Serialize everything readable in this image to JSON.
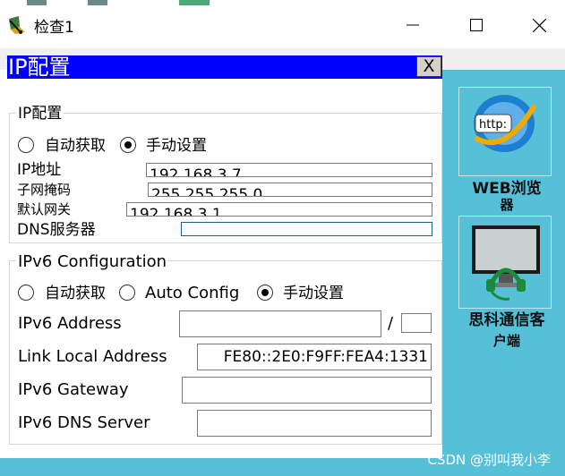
{
  "window": {
    "title": "检查1",
    "app_icon": "packet-tracer-icon",
    "controls": [
      "minimize-icon",
      "maximize-icon",
      "close-icon"
    ]
  },
  "panel": {
    "title": "IP配置",
    "close_label": "X"
  },
  "ipv4": {
    "legend": "IP配置",
    "mode_options": [
      {
        "label": "自动获取",
        "selected": false
      },
      {
        "label": "手动设置",
        "selected": true
      }
    ],
    "fields": {
      "ip_label": "IP地址",
      "ip_value": "192.168.3.7",
      "mask_label": "子网掩码",
      "mask_value": "255.255.255.0",
      "gateway_label": "默认网关",
      "gateway_value": "192.168.3.1",
      "dns_label": "DNS服务器",
      "dns_value": ""
    }
  },
  "ipv6": {
    "legend": "IPv6 Configuration",
    "mode_options": [
      {
        "label": "自动获取",
        "selected": false
      },
      {
        "label": "Auto Config",
        "selected": false
      },
      {
        "label": "手动设置",
        "selected": true
      }
    ],
    "address_label": "IPv6 Address",
    "address_value": "",
    "prefix_separator": "/",
    "prefix_value": "",
    "link_local_label": "Link Local Address",
    "link_local_value": "FE80::2E0:F9FF:FEA4:1331",
    "gateway_label": "IPv6 Gateway",
    "gateway_value": "",
    "dns_label": "IPv6 DNS Server",
    "dns_value": ""
  },
  "desktop": {
    "web_browser_label_line1": "WEB浏览",
    "web_browser_label_line2": "器",
    "web_tile_text": "http:",
    "pc_client_label_line1": "思科通信客",
    "pc_client_label_line2": "户端"
  },
  "watermark": "CSDN @别叫我小李",
  "colors": {
    "panel_title_bg": "#0000ff",
    "desktop_bg": "#56c0d8"
  }
}
